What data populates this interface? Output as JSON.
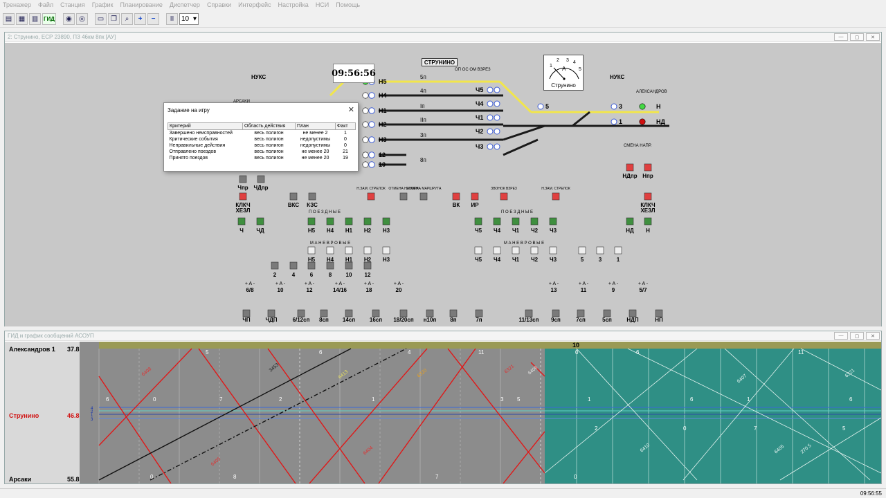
{
  "menu": [
    "Тренажер",
    "Файл",
    "Станция",
    "График",
    "Планирование",
    "Диспетчер",
    "Справки",
    "Интерфейс",
    "Настройка",
    "НСИ",
    "Помощь"
  ],
  "toolbar": {
    "gid_label": "ГИД",
    "pause_label": "II",
    "speed_value": "10"
  },
  "station_window": {
    "title": "2: Струнино, ЕСР 23890, ПЗ 46км 8пк [АУ]",
    "clock": "09:56:56",
    "station_name": "СТРУНИНО",
    "gauge_station": "Струнино",
    "gauge_ticks": [
      "1",
      "2",
      "3",
      "4",
      "5"
    ],
    "gauge_letter": "A"
  },
  "tracks": [
    {
      "signal": "Н5",
      "label": "5п"
    },
    {
      "signal": "Н4",
      "label": "4п"
    },
    {
      "signal": "Н1",
      "label": "Iп"
    },
    {
      "signal": "Н2",
      "label": "IIп"
    },
    {
      "signal": "Н3",
      "label": "3п"
    },
    {
      "signal": "12",
      "label": ""
    },
    {
      "signal": "10",
      "label": "8п"
    }
  ],
  "right_signals": [
    "Ч5",
    "Ч4",
    "Ч1",
    "Ч2",
    "Ч3"
  ],
  "far_signals": [
    "5",
    "3",
    "1"
  ],
  "exit_signals": [
    "Н",
    "НД"
  ],
  "labels": {
    "nuks": "НУКС",
    "arsaki": "АРСАКИ",
    "aleksandrov": "АЛЕКСАНДРОВ",
    "smena_napr": "СМЕНА НАПР.",
    "poezdnye": "П О Е З Д Н Ы Е",
    "manevrovye": "М А Н Е В Р О В Ы Е",
    "klkch_left": "КЛКЧ",
    "khezl_left": "ХЕЗЛ",
    "klkch_right": "КЛКЧ",
    "khezl_right": "ХЕЗЛ",
    "vks": "ВКС",
    "kzs": "КЗС",
    "otm_nabor": "ОТМЕНА НАБОРА",
    "otm_marsh": "ОТМЕНА МАРШРУТА",
    "vk": "ВК",
    "ir": "ИР",
    "zvonok": "ЗВОНОК ВЗРЕЗ",
    "n_zam_strelok": "Н.ЗАМ. СТРЕЛОК",
    "op_os_om_vzrez": "ОП ОС ОМ ВЗРЕЗ"
  },
  "dialog": {
    "title": "Задание на игру",
    "headers": [
      "Критерий",
      "Область действия",
      "План",
      "Факт"
    ],
    "rows": [
      [
        "Завершено неисправностей",
        "весь полигон",
        "не менее 2",
        "1"
      ],
      [
        "Критические события",
        "весь полигон",
        "недопустимы",
        "0"
      ],
      [
        "Неправильные действия",
        "весь полигон",
        "недопустимы",
        "0"
      ],
      [
        "Отправлено поездов",
        "весь полигон",
        "не менее 20",
        "21"
      ],
      [
        "Принято поездов",
        "весь полигон",
        "не менее 20",
        "19"
      ]
    ]
  },
  "buttons": {
    "top_left": [
      "Чпр",
      "ЧДпр"
    ],
    "top_right": [
      "НДпр",
      "Нпр"
    ],
    "poezd_left": [
      "Ч",
      "ЧД"
    ],
    "poezd_mid": [
      "Н5",
      "Н4",
      "Н1",
      "Н2",
      "Н3"
    ],
    "poezd_right": [
      "Ч5",
      "Ч4",
      "Ч1",
      "Ч2",
      "Ч3"
    ],
    "poezd_far": [
      "НД",
      "Н"
    ],
    "man_mid": [
      "Н5",
      "Н4",
      "Н1",
      "Н2",
      "Н3"
    ],
    "man_right": [
      "Ч5",
      "Ч4",
      "Ч1",
      "Ч2",
      "Ч3"
    ],
    "man_far": [
      "5",
      "3",
      "1"
    ],
    "man_row2": [
      "2",
      "4",
      "6",
      "8",
      "10",
      "12"
    ],
    "switches_left": [
      "6/8",
      "10",
      "12",
      "14/16",
      "18",
      "20"
    ],
    "switches_right": [
      "13",
      "11",
      "9",
      "5/7"
    ],
    "sections": [
      "ЧП",
      "ЧДП",
      "6/12сп",
      "8сп",
      "14сп",
      "16сп",
      "18/20сп",
      "н10п",
      "8п",
      "7п",
      "11/13сп",
      "9сп",
      "7сп",
      "5сп",
      "НДП",
      "НП"
    ]
  },
  "gid_window": {
    "title": "ГИД и график сообщений АСОУП",
    "hour_label": "10",
    "stations": [
      {
        "name": "Александров 1",
        "km": "37.8"
      },
      {
        "name": "Струнино",
        "km": "46.8"
      },
      {
        "name": "Арсаки",
        "km": "55.8"
      }
    ],
    "track_numbers": [
      "4",
      "2",
      "1",
      "3"
    ],
    "train_labels": [
      "6408",
      "6405",
      "6320",
      "6321",
      "6406",
      "6407",
      "6321",
      "6410",
      "6405",
      "270 5",
      "3453",
      "6413",
      "6404"
    ],
    "minute_labels": [
      "5",
      "6",
      "4",
      "11",
      "0",
      "6",
      "11",
      "6",
      "0",
      "7",
      "2",
      "1",
      "3",
      "5",
      "1",
      "6",
      "1",
      "6",
      "2",
      "0",
      "7",
      "5",
      "0",
      "8",
      "7",
      "0"
    ]
  },
  "status": {
    "time": "09:56:55"
  },
  "colors": {
    "track_occupied": "#f2e64a",
    "track_free": "#1a1a1a",
    "signal_green": "#44d844",
    "signal_red": "#d01010",
    "signal_blue": "#3b5bd6",
    "button_green": "#3f8f3f",
    "button_gray": "#7a7a7a",
    "button_red": "#e04040",
    "gid_future": "#2f8f85",
    "gid_red": "#e01818"
  }
}
